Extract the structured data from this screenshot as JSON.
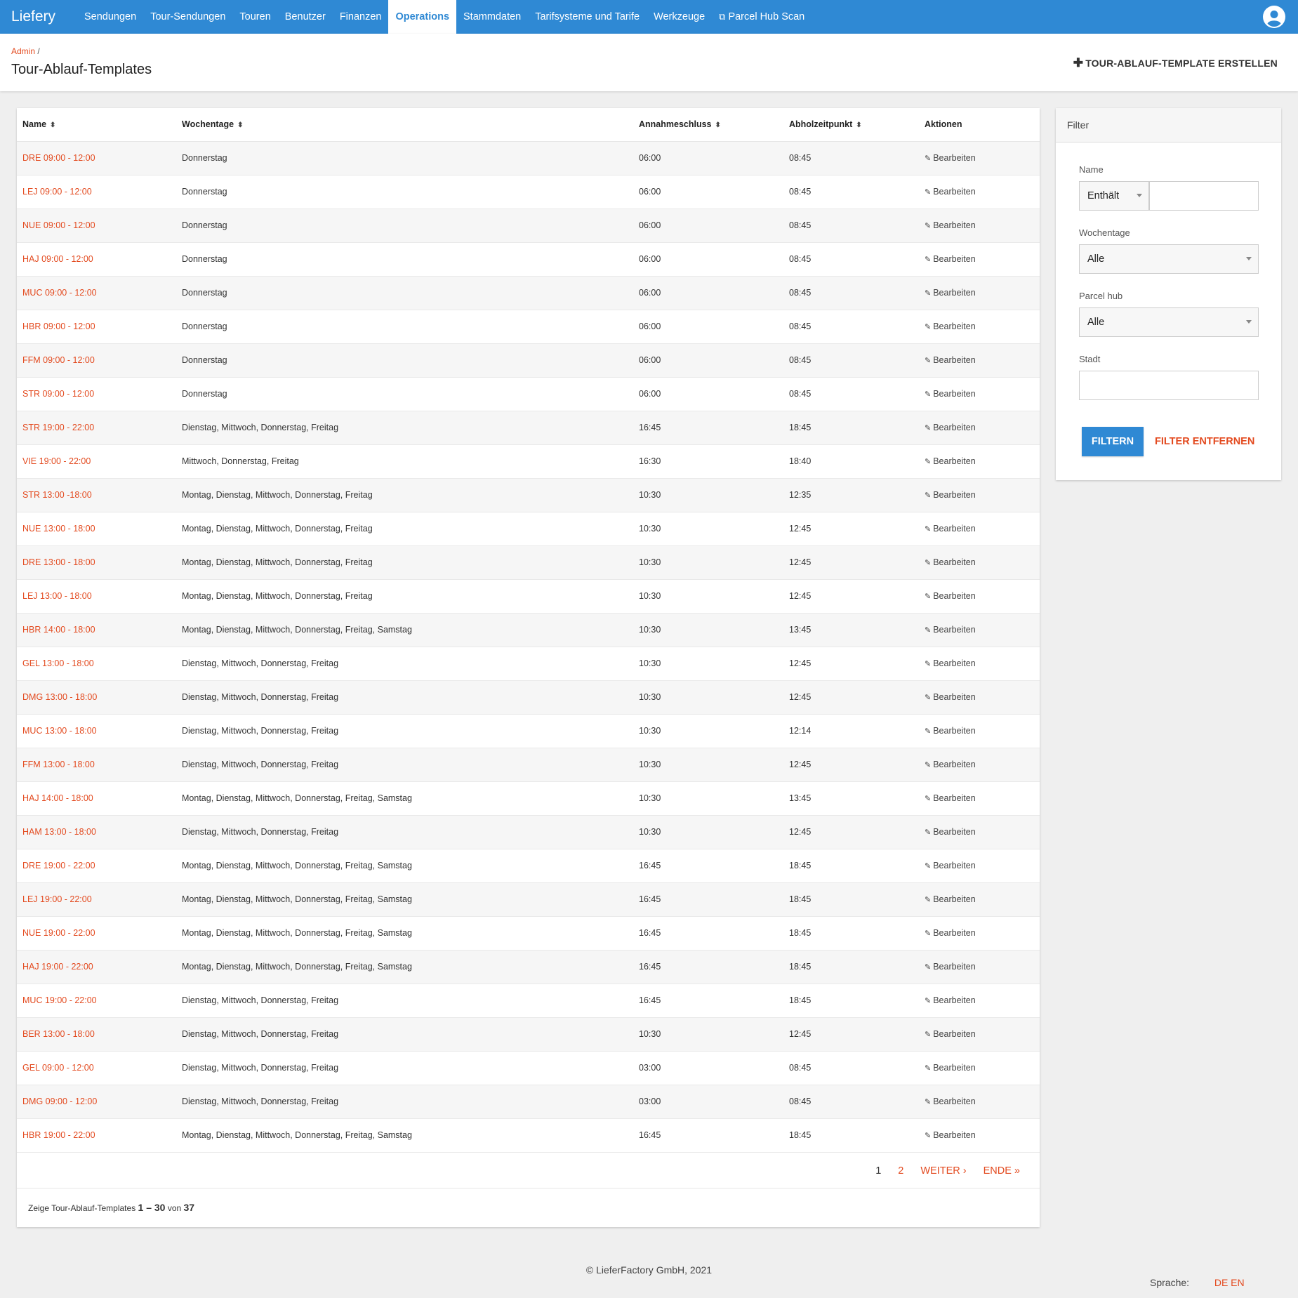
{
  "brand": "Liefery",
  "nav": {
    "items": [
      {
        "label": "Sendungen"
      },
      {
        "label": "Tour-Sendungen"
      },
      {
        "label": "Touren"
      },
      {
        "label": "Benutzer"
      },
      {
        "label": "Finanzen"
      },
      {
        "label": "Operations",
        "active": true
      },
      {
        "label": "Stammdaten"
      },
      {
        "label": "Tarifsysteme und Tarife"
      },
      {
        "label": "Werkzeuge"
      },
      {
        "label": "Parcel Hub Scan",
        "icon": "external-link-icon"
      }
    ]
  },
  "header": {
    "breadcrumb_root": "Admin",
    "breadcrumb_sep": "/",
    "title": "Tour-Ablauf-Templates",
    "create_label": "TOUR-ABLAUF-TEMPLATE ERSTELLEN"
  },
  "table": {
    "columns": [
      "Name",
      "Wochentage",
      "Annahmeschluss",
      "Abholzeitpunkt",
      "Aktionen"
    ],
    "action_label": "Bearbeiten",
    "rows": [
      [
        "DRE 09:00 - 12:00",
        "Donnerstag",
        "06:00",
        "08:45"
      ],
      [
        "LEJ 09:00 - 12:00",
        "Donnerstag",
        "06:00",
        "08:45"
      ],
      [
        "NUE 09:00 - 12:00",
        "Donnerstag",
        "06:00",
        "08:45"
      ],
      [
        "HAJ 09:00 - 12:00",
        "Donnerstag",
        "06:00",
        "08:45"
      ],
      [
        "MUC 09:00 - 12:00",
        "Donnerstag",
        "06:00",
        "08:45"
      ],
      [
        "HBR 09:00 - 12:00",
        "Donnerstag",
        "06:00",
        "08:45"
      ],
      [
        "FFM 09:00 - 12:00",
        "Donnerstag",
        "06:00",
        "08:45"
      ],
      [
        "STR 09:00 - 12:00",
        "Donnerstag",
        "06:00",
        "08:45"
      ],
      [
        "STR 19:00 - 22:00",
        "Dienstag, Mittwoch, Donnerstag, Freitag",
        "16:45",
        "18:45"
      ],
      [
        "VIE 19:00 - 22:00",
        "Mittwoch, Donnerstag, Freitag",
        "16:30",
        "18:40"
      ],
      [
        "STR 13:00 -18:00",
        "Montag, Dienstag, Mittwoch, Donnerstag, Freitag",
        "10:30",
        "12:35"
      ],
      [
        "NUE 13:00 - 18:00",
        "Montag, Dienstag, Mittwoch, Donnerstag, Freitag",
        "10:30",
        "12:45"
      ],
      [
        "DRE 13:00 - 18:00",
        "Montag, Dienstag, Mittwoch, Donnerstag, Freitag",
        "10:30",
        "12:45"
      ],
      [
        "LEJ 13:00 - 18:00",
        "Montag, Dienstag, Mittwoch, Donnerstag, Freitag",
        "10:30",
        "12:45"
      ],
      [
        "HBR 14:00 - 18:00",
        "Montag, Dienstag, Mittwoch, Donnerstag, Freitag, Samstag",
        "10:30",
        "13:45"
      ],
      [
        "GEL 13:00 - 18:00",
        "Dienstag, Mittwoch, Donnerstag, Freitag",
        "10:30",
        "12:45"
      ],
      [
        "DMG 13:00 - 18:00",
        "Dienstag, Mittwoch, Donnerstag, Freitag",
        "10:30",
        "12:45"
      ],
      [
        "MUC 13:00 - 18:00",
        "Dienstag, Mittwoch, Donnerstag, Freitag",
        "10:30",
        "12:14"
      ],
      [
        "FFM 13:00 - 18:00",
        "Dienstag, Mittwoch, Donnerstag, Freitag",
        "10:30",
        "12:45"
      ],
      [
        "HAJ 14:00 - 18:00",
        "Montag, Dienstag, Mittwoch, Donnerstag, Freitag, Samstag",
        "10:30",
        "13:45"
      ],
      [
        "HAM 13:00 - 18:00",
        "Dienstag, Mittwoch, Donnerstag, Freitag",
        "10:30",
        "12:45"
      ],
      [
        "DRE 19:00 - 22:00",
        "Montag, Dienstag, Mittwoch, Donnerstag, Freitag, Samstag",
        "16:45",
        "18:45"
      ],
      [
        "LEJ 19:00 - 22:00",
        "Montag, Dienstag, Mittwoch, Donnerstag, Freitag, Samstag",
        "16:45",
        "18:45"
      ],
      [
        "NUE 19:00 - 22:00",
        "Montag, Dienstag, Mittwoch, Donnerstag, Freitag, Samstag",
        "16:45",
        "18:45"
      ],
      [
        "HAJ 19:00 - 22:00",
        "Montag, Dienstag, Mittwoch, Donnerstag, Freitag, Samstag",
        "16:45",
        "18:45"
      ],
      [
        "MUC 19:00 - 22:00",
        "Dienstag, Mittwoch, Donnerstag, Freitag",
        "16:45",
        "18:45"
      ],
      [
        "BER 13:00 - 18:00",
        "Dienstag, Mittwoch, Donnerstag, Freitag",
        "10:30",
        "12:45"
      ],
      [
        "GEL 09:00 - 12:00",
        "Dienstag, Mittwoch, Donnerstag, Freitag",
        "03:00",
        "08:45"
      ],
      [
        "DMG 09:00 - 12:00",
        "Dienstag, Mittwoch, Donnerstag, Freitag",
        "03:00",
        "08:45"
      ],
      [
        "HBR 19:00 - 22:00",
        "Montag, Dienstag, Mittwoch, Donnerstag, Freitag, Samstag",
        "16:45",
        "18:45"
      ]
    ]
  },
  "pagination": {
    "page1": "1",
    "page2": "2",
    "next": "WEITER ›",
    "last": "ENDE »"
  },
  "summary": {
    "prefix": "Zeige Tour-Ablauf-Templates",
    "range": "1 – 30",
    "of": "von",
    "total": "37"
  },
  "filter": {
    "title": "Filter",
    "name_label": "Name",
    "name_mode": "Enthält",
    "name_value": "",
    "weekdays_label": "Wochentage",
    "weekdays_value": "Alle",
    "hub_label": "Parcel hub",
    "hub_value": "Alle",
    "city_label": "Stadt",
    "city_value": "",
    "apply_label": "FILTERN",
    "remove_label": "FILTER ENTFERNEN"
  },
  "footer": {
    "copyright": "© LieferFactory GmbH, 2021",
    "lang_label": "Sprache:",
    "lang_de": "DE",
    "lang_en": "EN"
  },
  "colors": {
    "primary": "#2f89d4",
    "link": "#e34a1f",
    "background": "#efefef"
  }
}
